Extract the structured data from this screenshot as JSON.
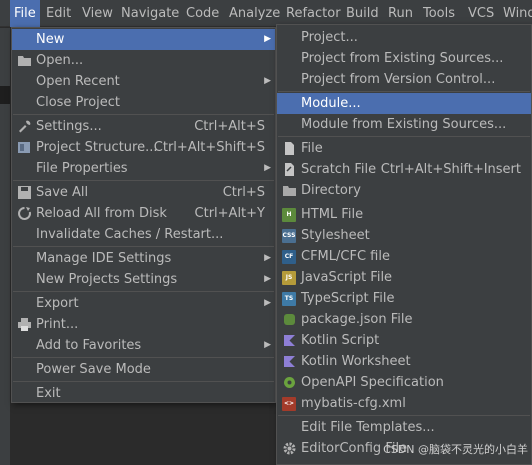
{
  "menubar": {
    "items": [
      {
        "label": "File"
      },
      {
        "label": "Edit"
      },
      {
        "label": "View"
      },
      {
        "label": "Navigate"
      },
      {
        "label": "Code"
      },
      {
        "label": "Analyze"
      },
      {
        "label": "Refactor"
      },
      {
        "label": "Build"
      },
      {
        "label": "Run"
      },
      {
        "label": "Tools"
      },
      {
        "label": "VCS"
      },
      {
        "label": "Window"
      }
    ]
  },
  "file_menu": {
    "items": [
      {
        "label": "New",
        "shortcut": ""
      },
      {
        "label": "Open...",
        "shortcut": ""
      },
      {
        "label": "Open Recent",
        "shortcut": ""
      },
      {
        "label": "Close Project",
        "shortcut": ""
      },
      {
        "label": "Settings...",
        "shortcut": "Ctrl+Alt+S"
      },
      {
        "label": "Project Structure...",
        "shortcut": "Ctrl+Alt+Shift+S"
      },
      {
        "label": "File Properties",
        "shortcut": ""
      },
      {
        "label": "Save All",
        "shortcut": "Ctrl+S"
      },
      {
        "label": "Reload All from Disk",
        "shortcut": "Ctrl+Alt+Y"
      },
      {
        "label": "Invalidate Caches / Restart...",
        "shortcut": ""
      },
      {
        "label": "Manage IDE Settings",
        "shortcut": ""
      },
      {
        "label": "New Projects Settings",
        "shortcut": ""
      },
      {
        "label": "Export",
        "shortcut": ""
      },
      {
        "label": "Print...",
        "shortcut": ""
      },
      {
        "label": "Add to Favorites",
        "shortcut": ""
      },
      {
        "label": "Power Save Mode",
        "shortcut": ""
      },
      {
        "label": "Exit",
        "shortcut": ""
      }
    ]
  },
  "new_menu": {
    "items": [
      {
        "label": "Project...",
        "shortcut": ""
      },
      {
        "label": "Project from Existing Sources...",
        "shortcut": ""
      },
      {
        "label": "Project from Version Control...",
        "shortcut": ""
      },
      {
        "label": "Module...",
        "shortcut": ""
      },
      {
        "label": "Module from Existing Sources...",
        "shortcut": ""
      },
      {
        "label": "File",
        "shortcut": ""
      },
      {
        "label": "Scratch File",
        "shortcut": "Ctrl+Alt+Shift+Insert"
      },
      {
        "label": "Directory",
        "shortcut": ""
      },
      {
        "label": "HTML File",
        "shortcut": ""
      },
      {
        "label": "Stylesheet",
        "shortcut": ""
      },
      {
        "label": "CFML/CFC file",
        "shortcut": ""
      },
      {
        "label": "JavaScript File",
        "shortcut": ""
      },
      {
        "label": "TypeScript File",
        "shortcut": ""
      },
      {
        "label": "package.json File",
        "shortcut": ""
      },
      {
        "label": "Kotlin Script",
        "shortcut": ""
      },
      {
        "label": "Kotlin Worksheet",
        "shortcut": ""
      },
      {
        "label": "OpenAPI Specification",
        "shortcut": ""
      },
      {
        "label": "mybatis-cfg.xml",
        "shortcut": ""
      },
      {
        "label": "Edit File Templates...",
        "shortcut": ""
      },
      {
        "label": "EditorConfig File",
        "shortcut": ""
      }
    ]
  },
  "icons": {
    "html": "H",
    "css": "CSS",
    "cfml": "CF",
    "js": "JS",
    "ts": "TS",
    "xml": "<>"
  },
  "colors": {
    "menu_bg": "#3c3f41",
    "selection": "#4b6eaf",
    "text": "#bbbbbb"
  },
  "watermark": "CSDN @脑袋不灵光的小白羊"
}
